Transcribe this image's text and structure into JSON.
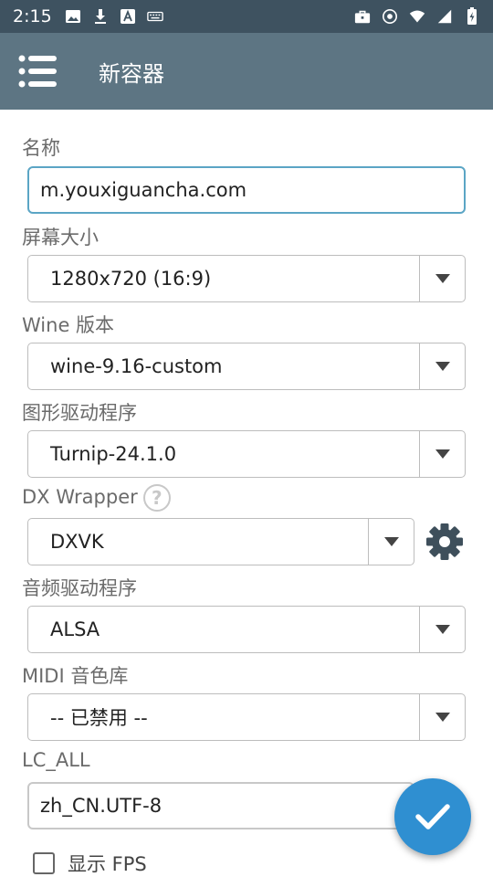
{
  "status_bar": {
    "time": "2:15"
  },
  "toolbar": {
    "title": "新容器"
  },
  "form": {
    "name_label": "名称",
    "name_value": "m.youxiguancha.com",
    "screen_label": "屏幕大小",
    "screen_value": "1280x720 (16:9)",
    "wine_label": "Wine 版本",
    "wine_value": "wine-9.16-custom",
    "graphics_label": "图形驱动程序",
    "graphics_value": "Turnip-24.1.0",
    "dx_label": "DX Wrapper",
    "dx_help": "?",
    "dx_value": "DXVK",
    "audio_label": "音频驱动程序",
    "audio_value": "ALSA",
    "midi_label": "MIDI 音色库",
    "midi_value": "-- 已禁用 --",
    "lc_label": "LC_ALL",
    "lc_value": "zh_CN.UTF-8",
    "fps_label": "显示 FPS"
  },
  "colors": {
    "status_bar": "#3e5260",
    "toolbar": "#5d7583",
    "focus_border": "#5ba5c5",
    "fab": "#2f8fd1",
    "gear": "#3e4f5b"
  }
}
